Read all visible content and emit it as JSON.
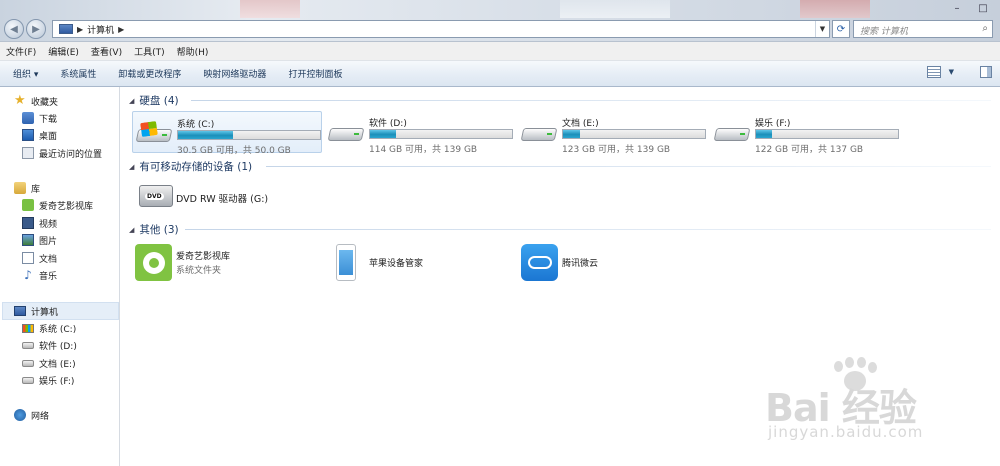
{
  "window": {
    "address_crumbs": [
      "计算机"
    ],
    "search_placeholder": "搜索 计算机"
  },
  "menu": [
    "文件(F)",
    "编辑(E)",
    "查看(V)",
    "工具(T)",
    "帮助(H)"
  ],
  "toolbar": [
    "组织 ▾",
    "系统属性",
    "卸载或更改程序",
    "映射网络驱动器",
    "打开控制面板"
  ],
  "sidebar": {
    "favorites_header": "收藏夹",
    "favorites": [
      "下载",
      "桌面",
      "最近访问的位置"
    ],
    "libraries_header": "库",
    "libraries": [
      "爱奇艺影视库",
      "视频",
      "图片",
      "文档",
      "音乐"
    ],
    "computer_header": "计算机",
    "drives": [
      "系统 (C:)",
      "软件 (D:)",
      "文档 (E:)",
      "娱乐 (F:)"
    ],
    "network": "网络"
  },
  "groups": {
    "hard_disks": "硬盘 (4)",
    "removable": "有可移动存储的设备 (1)",
    "other": "其他 (3)"
  },
  "drives": [
    {
      "name": "系统 (C:)",
      "info": "30.5 GB 可用，共 50.0 GB",
      "used_fraction": 0.39
    },
    {
      "name": "软件 (D:)",
      "info": "114 GB 可用，共 139 GB",
      "used_fraction": 0.18
    },
    {
      "name": "文档 (E:)",
      "info": "123 GB 可用，共 139 GB",
      "used_fraction": 0.12
    },
    {
      "name": "娱乐 (F:)",
      "info": "122 GB 可用，共 137 GB",
      "used_fraction": 0.11
    }
  ],
  "dvd": {
    "name": "DVD RW 驱动器 (G:)",
    "badge": "DVD"
  },
  "others": [
    {
      "name": "爱奇艺影视库",
      "sub": "系统文件夹"
    },
    {
      "name": "苹果设备管家",
      "sub": ""
    },
    {
      "name": "腾讯微云",
      "sub": ""
    }
  ],
  "watermark": {
    "brand": "Bai 经验",
    "site": "jingyan.baidu.com"
  }
}
